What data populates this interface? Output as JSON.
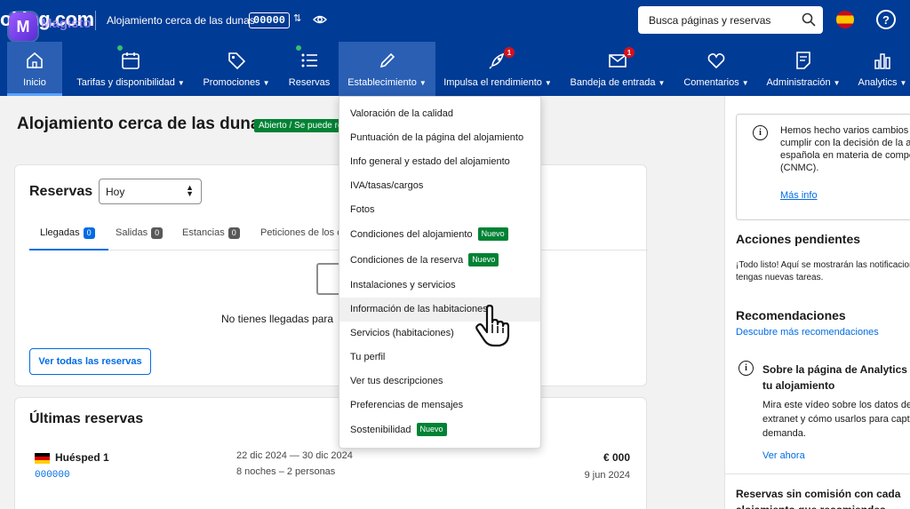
{
  "topbar": {
    "brand": "oking.com",
    "watermark": "Magisto",
    "property_name": "Alojamiento cerca de las dunas",
    "property_id": "00000",
    "search_label": "Busca páginas y reservas",
    "swap_icon": "swap-arrows-icon",
    "eye_icon": "eye-icon"
  },
  "nav": {
    "items": [
      {
        "label": "Inicio",
        "icon": "house-icon"
      },
      {
        "label": "Tarifas y disponibilidad",
        "icon": "calendar-icon"
      },
      {
        "label": "Promociones",
        "icon": "tag-icon"
      },
      {
        "label": "Reservas",
        "icon": "list-icon"
      },
      {
        "label": "Establecimiento",
        "icon": "pencil-icon"
      },
      {
        "label": "Impulsa el rendimiento",
        "icon": "rocket-icon",
        "badge": "1"
      },
      {
        "label": "Bandeja de entrada",
        "icon": "envelope-icon",
        "badge": "1"
      },
      {
        "label": "Comentarios",
        "icon": "heart-icon"
      },
      {
        "label": "Administración",
        "icon": "document-icon"
      },
      {
        "label": "Analytics",
        "icon": "bar-chart-icon"
      }
    ]
  },
  "main": {
    "title": "Alojamiento cerca de las dunas",
    "status": "Abierto / Se puede re",
    "reservas": {
      "title": "Reservas",
      "period": "Hoy",
      "tabs": [
        {
          "label": "Llegadas",
          "count": "0"
        },
        {
          "label": "Salidas",
          "count": "0"
        },
        {
          "label": "Estancias",
          "count": "0"
        },
        {
          "label": "Peticiones de los c"
        }
      ],
      "empty_text": "No tienes llegadas para",
      "view_all": "Ver todas las reservas"
    },
    "ultimas": {
      "title": "Últimas reservas",
      "guest": "Huésped 1",
      "guest_id": "000000",
      "dates": "22 dic 2024 — 30 dic 2024",
      "nights": "8 noches – 2 personas",
      "price": "€ 000",
      "booked": "9 jun 2024"
    }
  },
  "dropdown": {
    "new_label": "Nuevo",
    "items": [
      {
        "label": "Valoración de la calidad"
      },
      {
        "label": "Puntuación de la página del alojamiento"
      },
      {
        "label": "Info general y estado del alojamiento"
      },
      {
        "label": "IVA/tasas/cargos"
      },
      {
        "label": "Fotos"
      },
      {
        "label": "Condiciones del alojamiento",
        "new": true
      },
      {
        "label": "Condiciones de la reserva",
        "new": true
      },
      {
        "label": "Instalaciones y servicios"
      },
      {
        "label": "Información de las habitaciones",
        "hover": true
      },
      {
        "label": "Servicios (habitaciones)"
      },
      {
        "label": "Tu perfil"
      },
      {
        "label": "Ver tus descripciones"
      },
      {
        "label": "Preferencias de mensajes"
      },
      {
        "label": "Sostenibilidad",
        "new": true
      }
    ]
  },
  "sidebar": {
    "notice_text": "Hemos hecho varios cambios\ncumplir con la decisión de la a\nespañola en materia de compe\n(CNMC).",
    "notice_link": "Más info",
    "pending_title": "Acciones pendientes",
    "pending_text": "¡Todo listo! Aquí se mostrarán las notificacion\ntengas nuevas tareas.",
    "rec_title": "Recomendaciones",
    "rec_link": "Descubre más recomendaciones",
    "rec_card_title": "Sobre la página de Analytics\ntu alojamiento",
    "rec_card_text": "Mira este vídeo sobre los datos de\nextranet y cómo usarlos para capt\ndemanda.",
    "rec_card_link": "Ver ahora",
    "commission_title": "Reservas sin comisión con cada\nalojamiento que recomiendes"
  },
  "colors": {
    "brand_blue": "#003b95",
    "accent_blue": "#006ce4",
    "new_green": "#008234",
    "alert_red": "#d4111e"
  }
}
